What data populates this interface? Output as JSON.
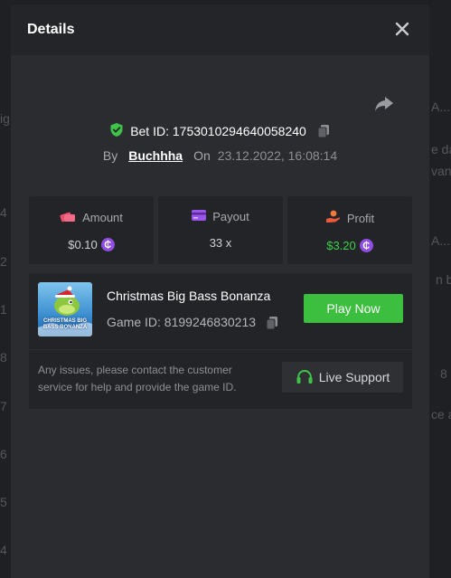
{
  "background": {
    "fragments": [
      "ig",
      "e da",
      "van",
      "A...",
      "4",
      "2",
      "n bo",
      "1",
      "A...",
      "8",
      "8",
      "7",
      "ce a",
      "6",
      "5",
      "4"
    ]
  },
  "modal": {
    "title": "Details",
    "close_icon": "close-icon",
    "share_icon": "share-icon",
    "bet_id_label": "Bet ID: 1753010294640058240",
    "by_label": "By",
    "username": "Buchhha",
    "on_label": "On",
    "date": "23.12.2022, 16:08:14"
  },
  "stats": {
    "amount": {
      "label": "Amount",
      "value": "$0.10"
    },
    "payout": {
      "label": "Payout",
      "value": "33 x"
    },
    "profit": {
      "label": "Profit",
      "value": "$3.20"
    },
    "coin_symbol": "₵"
  },
  "game": {
    "name": "Christmas Big Bass Bonanza",
    "game_id": "Game ID: 8199246830213",
    "thumb_text": "CHRISTMAS BIG BASS BONANZA",
    "play_label": "Play Now",
    "support_text": "Any issues, please contact the customer service for help and provide the game ID.",
    "support_label": "Live Support"
  },
  "colors": {
    "accent_green": "#3cbf3f",
    "coin_purple": "#8f4ee0",
    "profit_green": "#3fd14c"
  }
}
